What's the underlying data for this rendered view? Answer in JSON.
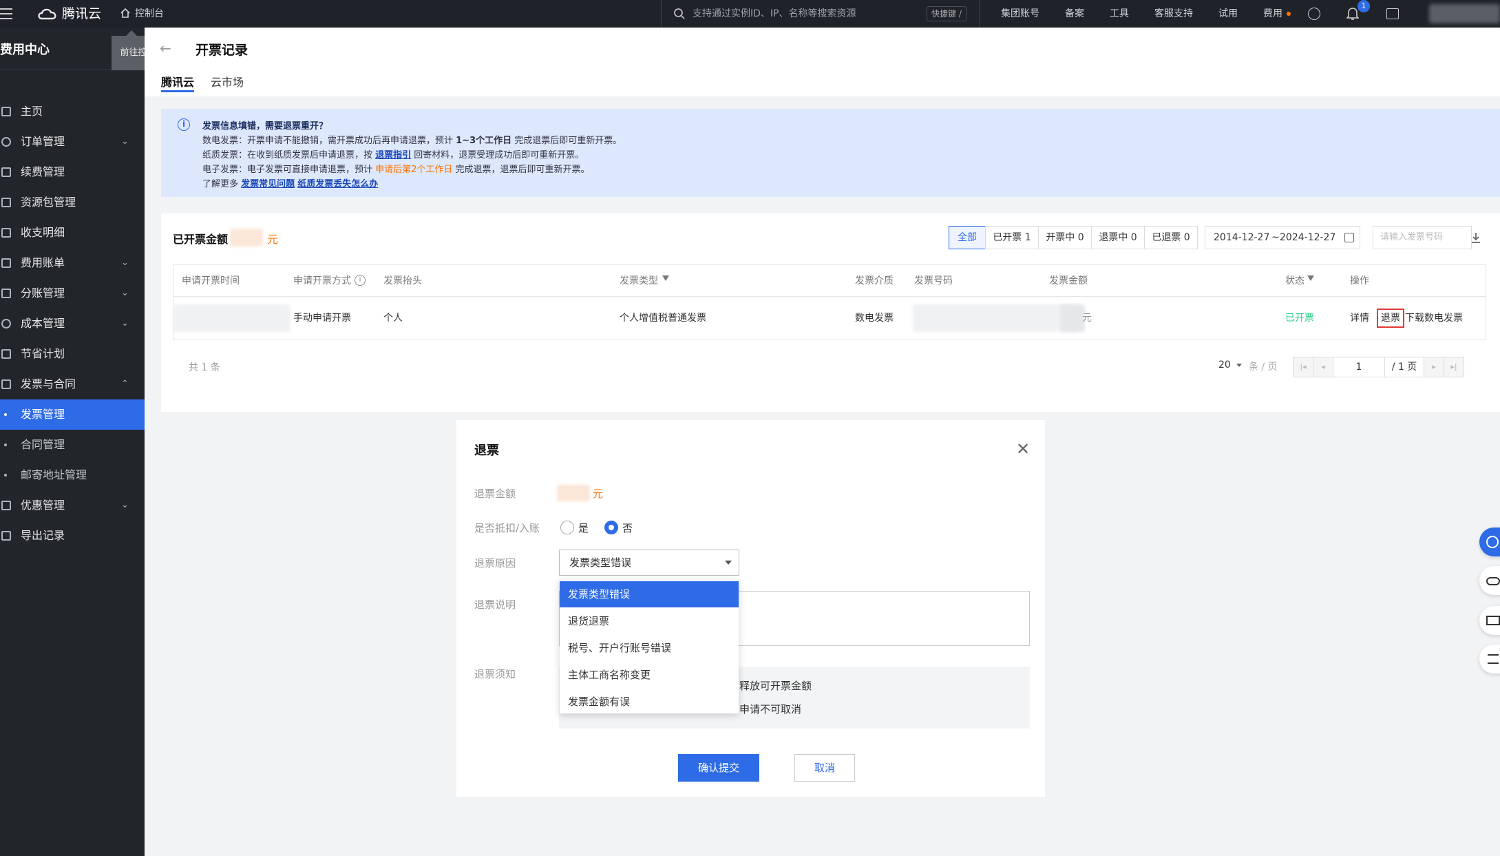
{
  "topbar": {
    "brand": "腾讯云",
    "console": "控制台",
    "search_placeholder": "支持通过实例ID、IP、名称等搜索资源",
    "shortcut": "快捷键 /",
    "nav": [
      "集团账号",
      "备案",
      "工具",
      "客服支持",
      "试用",
      "费用"
    ],
    "notification_count": "1"
  },
  "sidebar": {
    "title": "费用中心",
    "tooltip": "前往控制台总览",
    "items": [
      {
        "label": "主页"
      },
      {
        "label": "订单管理"
      },
      {
        "label": "续费管理"
      },
      {
        "label": "资源包管理"
      },
      {
        "label": "收支明细"
      },
      {
        "label": "费用账单"
      },
      {
        "label": "分账管理"
      },
      {
        "label": "成本管理"
      },
      {
        "label": "节省计划"
      },
      {
        "label": "发票与合同"
      },
      {
        "label": "发票管理"
      },
      {
        "label": "合同管理"
      },
      {
        "label": "邮寄地址管理"
      },
      {
        "label": "优惠管理"
      },
      {
        "label": "导出记录"
      }
    ]
  },
  "page": {
    "title": "开票记录",
    "tabs": [
      "腾讯云",
      "云市场"
    ]
  },
  "notice": {
    "heading": "发票信息填错，需要退票重开？",
    "line1_a": "数电发票：开票申请不能撤销，需开票成功后再申请退票，预计 ",
    "line1_b": "1~3个工作日",
    "line1_c": " 完成退票后即可重新开票。",
    "line2_a": "纸质发票：在收到纸质发票后申请退票，按 ",
    "line2_link": "退票指引",
    "line2_b": " 回寄材料，退票受理成功后即可重新开票。",
    "line3_a": "电子发票：电子发票可直接申请退票，预计 ",
    "line3_b": "申请后第2个工作日",
    "line3_c": " 完成退票，退票后即可重新开票。",
    "line4_a": "了解更多 ",
    "link_faq": "发票常见问题",
    "link_lost": "纸质发票丢失怎么办"
  },
  "records": {
    "amount_label": "已开票金额",
    "amount_unit": "元",
    "filters": [
      "全部",
      "已开票 1",
      "开票中 0",
      "退票中 0",
      "已退票 0"
    ],
    "date_start": "2014-12-27",
    "date_sep": "~",
    "date_end": "2024-12-27",
    "search_placeholder": "请输入发票号码",
    "columns": [
      "申请开票时间",
      "申请开票方式",
      "发票抬头",
      "发票类型",
      "发票介质",
      "发票号码",
      "发票金额",
      "状态",
      "操作"
    ],
    "row": {
      "method": "手动申请开票",
      "title": "个人",
      "type": "个人增值税普通发票",
      "medium": "数电发票",
      "amount_suffix": "元",
      "status": "已开票",
      "actions": [
        "详情",
        "退票",
        "下载数电发票"
      ]
    },
    "total": "共 1 条",
    "page_size": "20",
    "page_size_unit": "条 / 页",
    "page_input": "1",
    "page_total": "/ 1 页"
  },
  "modal": {
    "title": "退票",
    "amount_label": "退票金额",
    "amount_unit": "元",
    "deduct_label": "是否抵扣/入账",
    "yes": "是",
    "no": "否",
    "selected_deduct": "否",
    "reason_label": "退票原因",
    "reason_value": "发票类型错误",
    "desc_label": "退票说明",
    "notice_label": "退票须知",
    "notice_line1": "释放可开票金额",
    "notice_line2": "申请不可取消",
    "dropdown_options": [
      "发票类型错误",
      "退货退票",
      "税号、开户行账号错误",
      "主体工商名称变更",
      "发票金额有误"
    ],
    "confirm": "确认提交",
    "cancel": "取消"
  },
  "colors": {
    "accent": "#2e6be6",
    "sidebar_bg": "#22262b",
    "topbar_bg": "#1f2329",
    "orange": "#ff7200",
    "success": "#29cc85",
    "notice_bg": "#dde8fd"
  }
}
